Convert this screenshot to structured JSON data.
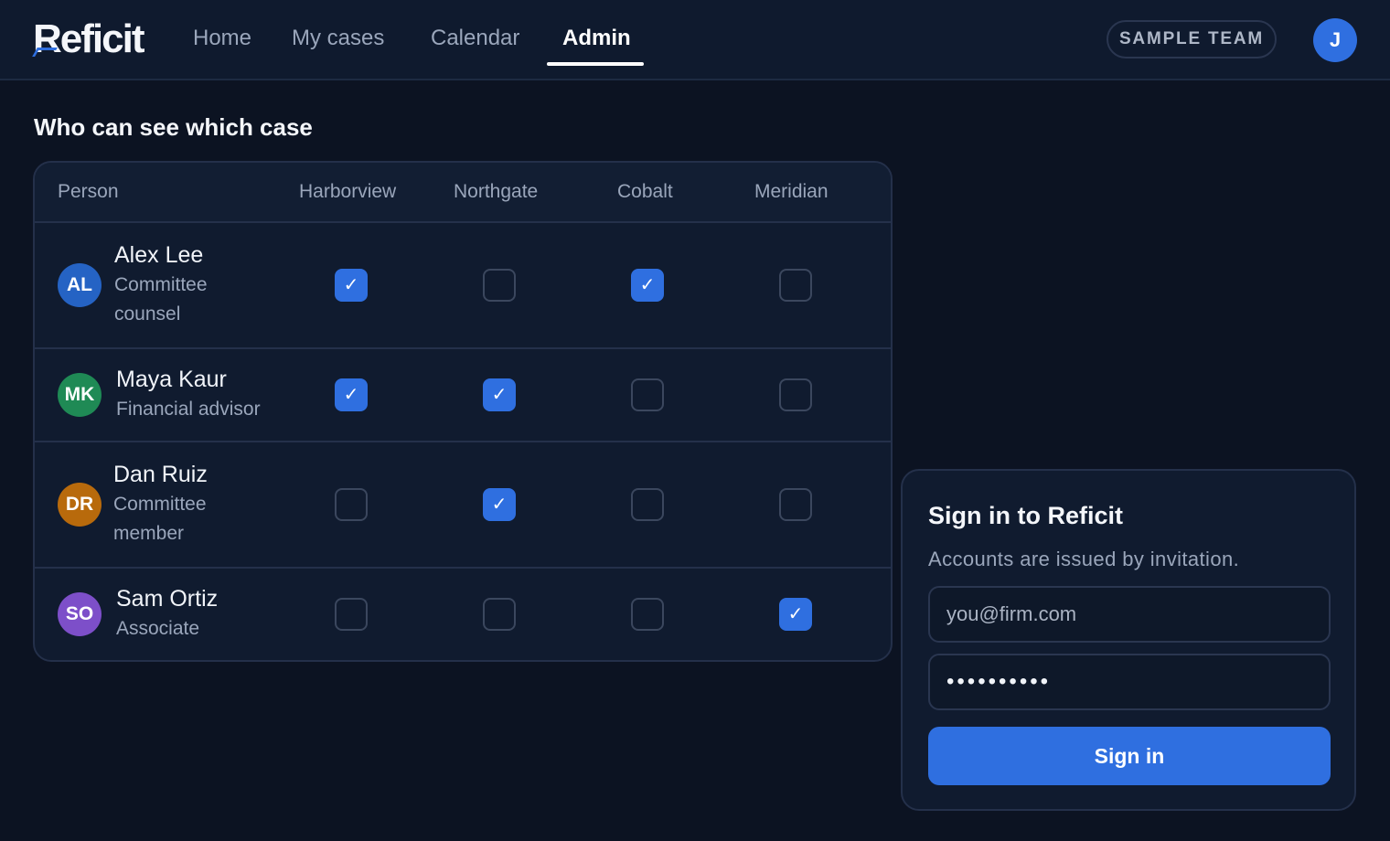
{
  "brand": {
    "logo_text": "Reficit",
    "accent": "#2f6fe0"
  },
  "nav": {
    "items": [
      {
        "label": "Home",
        "active": false
      },
      {
        "label": "My cases",
        "active": false
      },
      {
        "label": "Calendar",
        "active": false
      },
      {
        "label": "Admin",
        "active": true
      }
    ]
  },
  "header": {
    "team_badge": "SAMPLE TEAM",
    "user_avatar_initial": "J"
  },
  "access_table": {
    "title": "Who can see which case",
    "columns": [
      "Person",
      "Harborview",
      "Northgate",
      "Cobalt",
      "Meridian"
    ],
    "rows": [
      {
        "initials": "AL",
        "avatar_color": "#2563c4",
        "name": "Alex Lee",
        "role": "Committee counsel",
        "access": [
          true,
          false,
          true,
          false
        ]
      },
      {
        "initials": "MK",
        "avatar_color": "#1f8a55",
        "name": "Maya Kaur",
        "role": "Financial advisor",
        "access": [
          true,
          true,
          false,
          false
        ]
      },
      {
        "initials": "DR",
        "avatar_color": "#b86a0c",
        "name": "Dan Ruiz",
        "role": "Committee member",
        "access": [
          false,
          true,
          false,
          false
        ]
      },
      {
        "initials": "SO",
        "avatar_color": "#7d4fc9",
        "name": "Sam Ortiz",
        "role": "Associate",
        "access": [
          false,
          false,
          false,
          true
        ]
      }
    ],
    "check_glyph": "✓"
  },
  "signin": {
    "title": "Sign in to Reficit",
    "subtitle": "Accounts are issued by invitation.",
    "email_placeholder": "you@firm.com",
    "password_mask": "••••••••••",
    "button_label": "Sign in"
  }
}
